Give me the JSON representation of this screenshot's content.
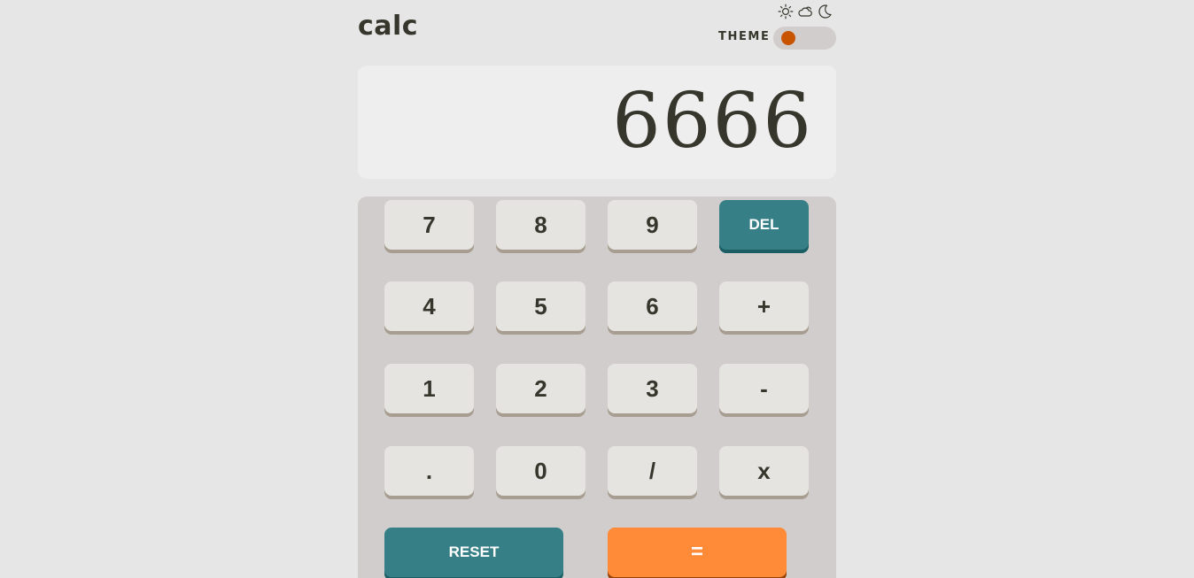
{
  "header": {
    "logo": "calc",
    "theme_label": "THEME",
    "theme_icons": [
      "sun-icon",
      "cloud-sun-icon",
      "moon-icon"
    ],
    "selected_theme": 1
  },
  "display": {
    "value": "6666"
  },
  "keys": {
    "seven": "7",
    "eight": "8",
    "nine": "9",
    "del": "DEL",
    "four": "4",
    "five": "5",
    "six": "6",
    "plus": "+",
    "one": "1",
    "two": "2",
    "three": "3",
    "minus": "-",
    "dot": ".",
    "zero": "0",
    "divide": "/",
    "multiply": "x",
    "reset": "RESET",
    "equals": "="
  },
  "colors": {
    "background": "#e6e6e6",
    "keypad": "#d2cdcd",
    "screen": "#eeeeee",
    "key": "#e5e4e0",
    "accent_teal": "#377f86",
    "accent_orange": "#ff8a38",
    "toggle_knob": "#c85402",
    "text": "#36362c"
  }
}
